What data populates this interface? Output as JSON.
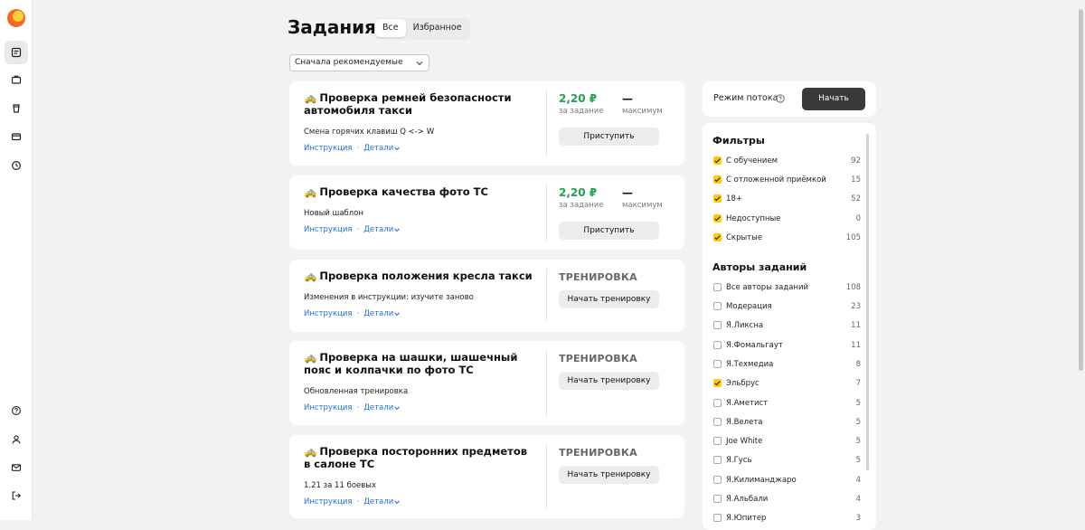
{
  "header": {
    "title": "Задания"
  },
  "tabs": [
    {
      "label": "Все",
      "active": true
    },
    {
      "label": "Избранное",
      "active": false
    }
  ],
  "sort": {
    "value": "Сначала рекомендуемые"
  },
  "icons": {
    "logo": "app-logo-icon",
    "car": "🚕",
    "sidebar": [
      "tasks-icon",
      "briefcase-icon",
      "cup-icon",
      "wallet-icon",
      "history-icon",
      "help-icon",
      "profile-icon",
      "mail-icon",
      "logout-icon"
    ]
  },
  "tasks": [
    {
      "title": "Проверка ремней безопасности автомобиля такси",
      "subtitle": "Смена горячих клавиш Q <-> W",
      "instruction": "Инструкция",
      "details": "Детали",
      "price": "2,20 ₽",
      "price_label": "за задание",
      "max": "—",
      "max_label": "максимум",
      "button": "Приступить"
    },
    {
      "title": "Проверка качества фото ТС",
      "subtitle": "Новый шаблон",
      "instruction": "Инструкция",
      "details": "Детали",
      "price": "2,20 ₽",
      "price_label": "за задание",
      "max": "—",
      "max_label": "максимум",
      "button": "Приступить"
    },
    {
      "title": "Проверка положения кресла такси",
      "subtitle": "Изменения в инструкции: изучите заново",
      "instruction": "Инструкция",
      "details": "Детали",
      "status": "ТРЕНИРОВКА",
      "button": "Начать тренировку"
    },
    {
      "title": "Проверка на шашки, шашечный пояс и колпачки по фото ТС",
      "subtitle": "Обновленная тренировка",
      "instruction": "Инструкция",
      "details": "Детали",
      "status": "ТРЕНИРОВКА",
      "button": "Начать тренировку"
    },
    {
      "title": "Проверка посторонних предметов в салоне ТС",
      "subtitle": "1.21 за 11 боевых",
      "instruction": "Инструкция",
      "details": "Детали",
      "status": "ТРЕНИРОВКА",
      "button": "Начать тренировку"
    }
  ],
  "stream": {
    "label": "Режим потока",
    "button": "Начать"
  },
  "filters": {
    "title": "Фильтры",
    "items": [
      {
        "label": "С обучением",
        "count": "92",
        "checked": true
      },
      {
        "label": "С отложенной приёмкой",
        "count": "15",
        "checked": true
      },
      {
        "label": "18+",
        "count": "52",
        "checked": true
      },
      {
        "label": "Недоступные",
        "count": "0",
        "checked": true
      },
      {
        "label": "Скрытые",
        "count": "105",
        "checked": true
      }
    ]
  },
  "authors": {
    "title": "Авторы заданий",
    "items": [
      {
        "label": "Все авторы заданий",
        "count": "108",
        "checked": false
      },
      {
        "label": "Модерация",
        "count": "23",
        "checked": false
      },
      {
        "label": "Я.Ликсна",
        "count": "11",
        "checked": false
      },
      {
        "label": "Я.Фомальгаут",
        "count": "11",
        "checked": false
      },
      {
        "label": "Я.Техмедиа",
        "count": "8",
        "checked": false
      },
      {
        "label": "Эльбрус",
        "count": "7",
        "checked": true
      },
      {
        "label": "Я.Аметист",
        "count": "5",
        "checked": false
      },
      {
        "label": "Я.Велета",
        "count": "5",
        "checked": false
      },
      {
        "label": "Joe White",
        "count": "5",
        "checked": false
      },
      {
        "label": "Я.Гусь",
        "count": "5",
        "checked": false
      },
      {
        "label": "Я.Килиманджаро",
        "count": "4",
        "checked": false
      },
      {
        "label": "Я.Альбали",
        "count": "4",
        "checked": false
      },
      {
        "label": "Я.Юпитер",
        "count": "3",
        "checked": false
      }
    ]
  }
}
